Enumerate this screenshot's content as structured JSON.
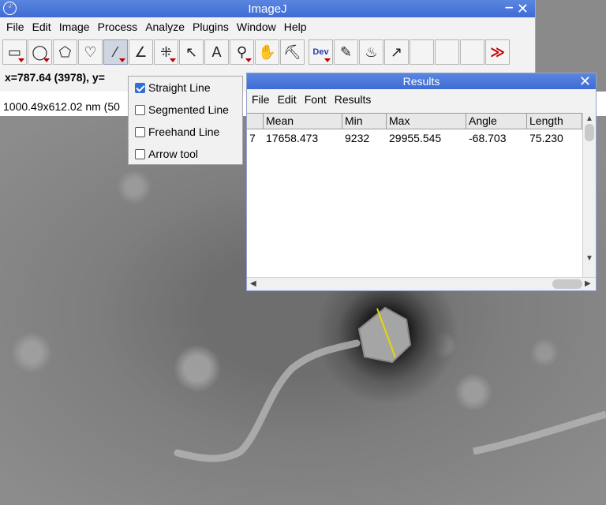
{
  "imagej": {
    "title": "ImageJ",
    "menu": [
      "File",
      "Edit",
      "Image",
      "Process",
      "Analyze",
      "Plugins",
      "Window",
      "Help"
    ],
    "tools": [
      {
        "name": "rectangle-icon",
        "glyph": "▭"
      },
      {
        "name": "oval-icon",
        "glyph": "◯"
      },
      {
        "name": "polygon-icon",
        "glyph": "⬠"
      },
      {
        "name": "freehand-icon",
        "glyph": "♡"
      },
      {
        "name": "line-icon",
        "glyph": "⁄"
      },
      {
        "name": "angle-icon",
        "glyph": "∠"
      },
      {
        "name": "multipoint-icon",
        "glyph": "⁜"
      },
      {
        "name": "wand-icon",
        "glyph": "↖"
      },
      {
        "name": "text-icon",
        "glyph": "A"
      },
      {
        "name": "zoom-icon",
        "glyph": "⚲"
      },
      {
        "name": "hand-icon",
        "glyph": "✋"
      },
      {
        "name": "dropper-icon",
        "glyph": "⛏"
      },
      {
        "name": "dev-icon",
        "glyph": "Dev"
      },
      {
        "name": "brush-icon",
        "glyph": "✎"
      },
      {
        "name": "flood-icon",
        "glyph": "♨"
      },
      {
        "name": "arrow-icon",
        "glyph": "↗"
      },
      {
        "name": "empty-slot-icon",
        "glyph": ""
      },
      {
        "name": "empty-slot-icon",
        "glyph": ""
      },
      {
        "name": "empty-slot-icon",
        "glyph": ""
      },
      {
        "name": "more-tools-icon",
        "glyph": "≫"
      }
    ],
    "status": "x=787.64 (3978), y="
  },
  "image_info": "1000.49x612.02 nm (50",
  "line_menu": {
    "items": [
      {
        "label": "Straight Line",
        "checked": true
      },
      {
        "label": "Segmented Line",
        "checked": false
      },
      {
        "label": "Freehand Line",
        "checked": false
      },
      {
        "label": "Arrow tool",
        "checked": false
      }
    ]
  },
  "results": {
    "title": "Results",
    "menu": [
      "File",
      "Edit",
      "Font",
      "Results"
    ],
    "columns": [
      "",
      "Mean",
      "Min",
      "Max",
      "Angle",
      "Length"
    ],
    "rows": [
      [
        "7",
        "17658.473",
        "9232",
        "29955.545",
        "-68.703",
        "75.230"
      ]
    ]
  },
  "colors": {
    "titlebar": "#3e6cd4",
    "measure_line": "#e6d800"
  }
}
